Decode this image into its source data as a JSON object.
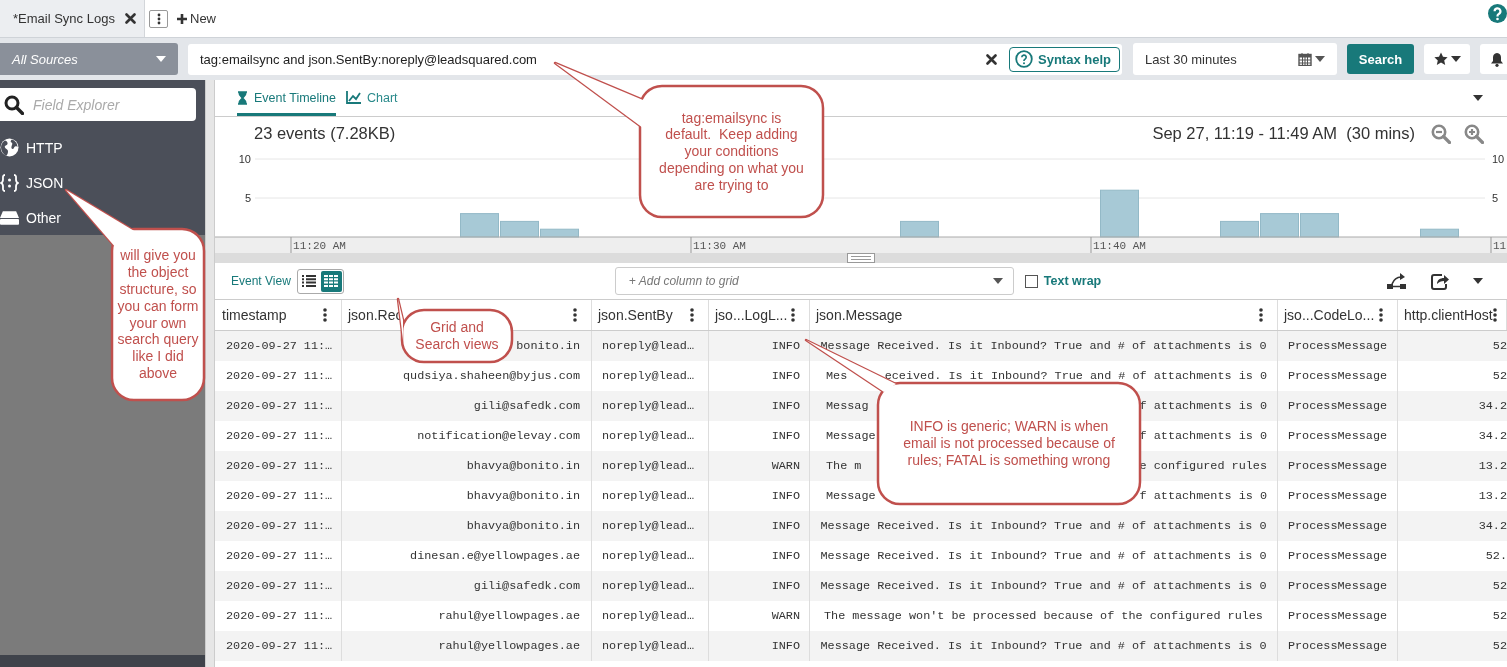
{
  "tabs": [
    {
      "label": "*Email Sync Logs",
      "selected": true
    }
  ],
  "new_button": "New",
  "search_bar": {
    "source": "All Sources",
    "query": "tag:emailsync and json.SentBy:noreply@leadsquared.com",
    "syntax_help": "Syntax help",
    "time_range": "Last 30 minutes",
    "search_button": "Search"
  },
  "sidebar": {
    "placeholder": "Field Explorer",
    "items": [
      {
        "label": "HTTP",
        "kind": "globe"
      },
      {
        "label": "JSON",
        "kind": "braces"
      },
      {
        "label": "Other",
        "kind": "drive"
      }
    ]
  },
  "view_tabs": [
    {
      "label": "Event Timeline",
      "kind": "timeline",
      "selected": true
    },
    {
      "label": "Chart",
      "kind": "chart",
      "selected": false
    }
  ],
  "summary": "23 events (7.28KB)",
  "time_span": "Sep 27, 11:19 - 11:49 AM  (30 mins)",
  "chart_data": {
    "type": "bar",
    "categories": [
      null,
      null,
      "11:20 AM",
      null,
      null,
      null,
      null,
      null,
      null,
      null,
      null,
      null,
      "11:30 AM",
      null,
      null,
      null,
      null,
      null,
      null,
      null,
      null,
      null,
      "11:40 AM",
      null,
      null,
      null,
      null,
      null,
      null,
      null,
      null,
      null
    ],
    "values": [
      null,
      null,
      null,
      null,
      null,
      null,
      3,
      2,
      1,
      null,
      null,
      null,
      null,
      null,
      null,
      null,
      null,
      2,
      null,
      null,
      null,
      null,
      6,
      null,
      null,
      2,
      3,
      3,
      null,
      null,
      1,
      null
    ],
    "ylim": [
      0,
      10
    ],
    "yticks": [
      {
        "value": 5,
        "label": "5"
      },
      {
        "value": 10,
        "label": "10"
      }
    ]
  },
  "chart_edge_label": "11",
  "chart_right_ticks": [
    "10",
    "5"
  ],
  "grid_toolbar": {
    "label": "Event View",
    "modes": [
      {
        "kind": "list",
        "selected": false
      },
      {
        "kind": "grid",
        "selected": true
      }
    ],
    "placeholder": "+ Add column to grid",
    "text_wrap": {
      "label": "Text wrap",
      "checked": false
    }
  },
  "table": {
    "columns": [
      "timestamp",
      "json.Rec",
      "json.SentBy",
      "jso...LogL...",
      "json.Message",
      "jso...CodeLo...",
      "http.clientHost"
    ],
    "rows": [
      {
        "cells": [
          "2020-09-27 11:…",
          "bonito.in",
          "noreply@lead…",
          "INFO",
          "Message Received. Is it Inbound? True and # of attachments is 0",
          "ProcessMessage",
          "52"
        ]
      },
      {
        "cells": [
          "2020-09-27 11:…",
          "qudsiya.shaheen@byjus.com",
          "noreply@lead…",
          "INFO",
          [
            "Mes",
            "eceived. Is it Inbound? True and # of attachments is 0"
          ],
          "ProcessMessage",
          "52"
        ]
      },
      {
        "cells": [
          "2020-09-27 11:…",
          "gili@safedk.com",
          "noreply@lead…",
          "INFO",
          [
            "Messag",
            "f attachments is 0"
          ],
          "ProcessMessage",
          "34.2"
        ]
      },
      {
        "cells": [
          "2020-09-27 11:…",
          "notification@elevay.com",
          "noreply@lead…",
          "INFO",
          [
            "Message",
            "f attachments is 0"
          ],
          "ProcessMessage",
          "34.2"
        ]
      },
      {
        "cells": [
          "2020-09-27 11:…",
          "bhavya@bonito.in",
          "noreply@lead…",
          "WARN",
          [
            "The m",
            "e configured rules"
          ],
          "ProcessMessage",
          "13.2"
        ]
      },
      {
        "cells": [
          "2020-09-27 11:…",
          "bhavya@bonito.in",
          "noreply@lead…",
          "INFO",
          [
            "Message",
            "f attachments is 0"
          ],
          "ProcessMessage",
          "13.2"
        ]
      },
      {
        "cells": [
          "2020-09-27 11:…",
          "bhavya@bonito.in",
          "noreply@lead…",
          "INFO",
          "Message Received. Is it Inbound? True and # of attachments is 0",
          "ProcessMessage",
          "34.2"
        ]
      },
      {
        "cells": [
          "2020-09-27 11:…",
          "dinesan.e@yellowpages.ae",
          "noreply@lead…",
          "INFO",
          "Message Received. Is it Inbound? True and # of attachments is 0",
          "ProcessMessage",
          "52."
        ]
      },
      {
        "cells": [
          "2020-09-27 11:…",
          "gili@safedk.com",
          "noreply@lead…",
          "INFO",
          "Message Received. Is it Inbound? True and # of attachments is 0",
          "ProcessMessage",
          "52"
        ]
      },
      {
        "cells": [
          "2020-09-27 11:…",
          "rahul@yellowpages.ae",
          "noreply@lead…",
          "WARN",
          "The message won't be processed because of the configured rules",
          "ProcessMessage",
          "52"
        ]
      },
      {
        "cells": [
          "2020-09-27 11:…",
          "rahul@yellowpages.ae",
          "noreply@lead…",
          "INFO",
          "Message Received. Is it Inbound? True and # of attachments is 0",
          "ProcessMessage",
          "52"
        ]
      }
    ]
  },
  "callouts": [
    {
      "text": "tag:emailsync is default.  Keep adding your conditions depending on what you are trying to"
    },
    {
      "text": "will give you the object structure, so you can form your own search query like I did above"
    },
    {
      "text": "Grid and Search views"
    },
    {
      "text": "INFO is generic; WARN is when email is not processed because of rules; FATAL is something wrong"
    }
  ]
}
